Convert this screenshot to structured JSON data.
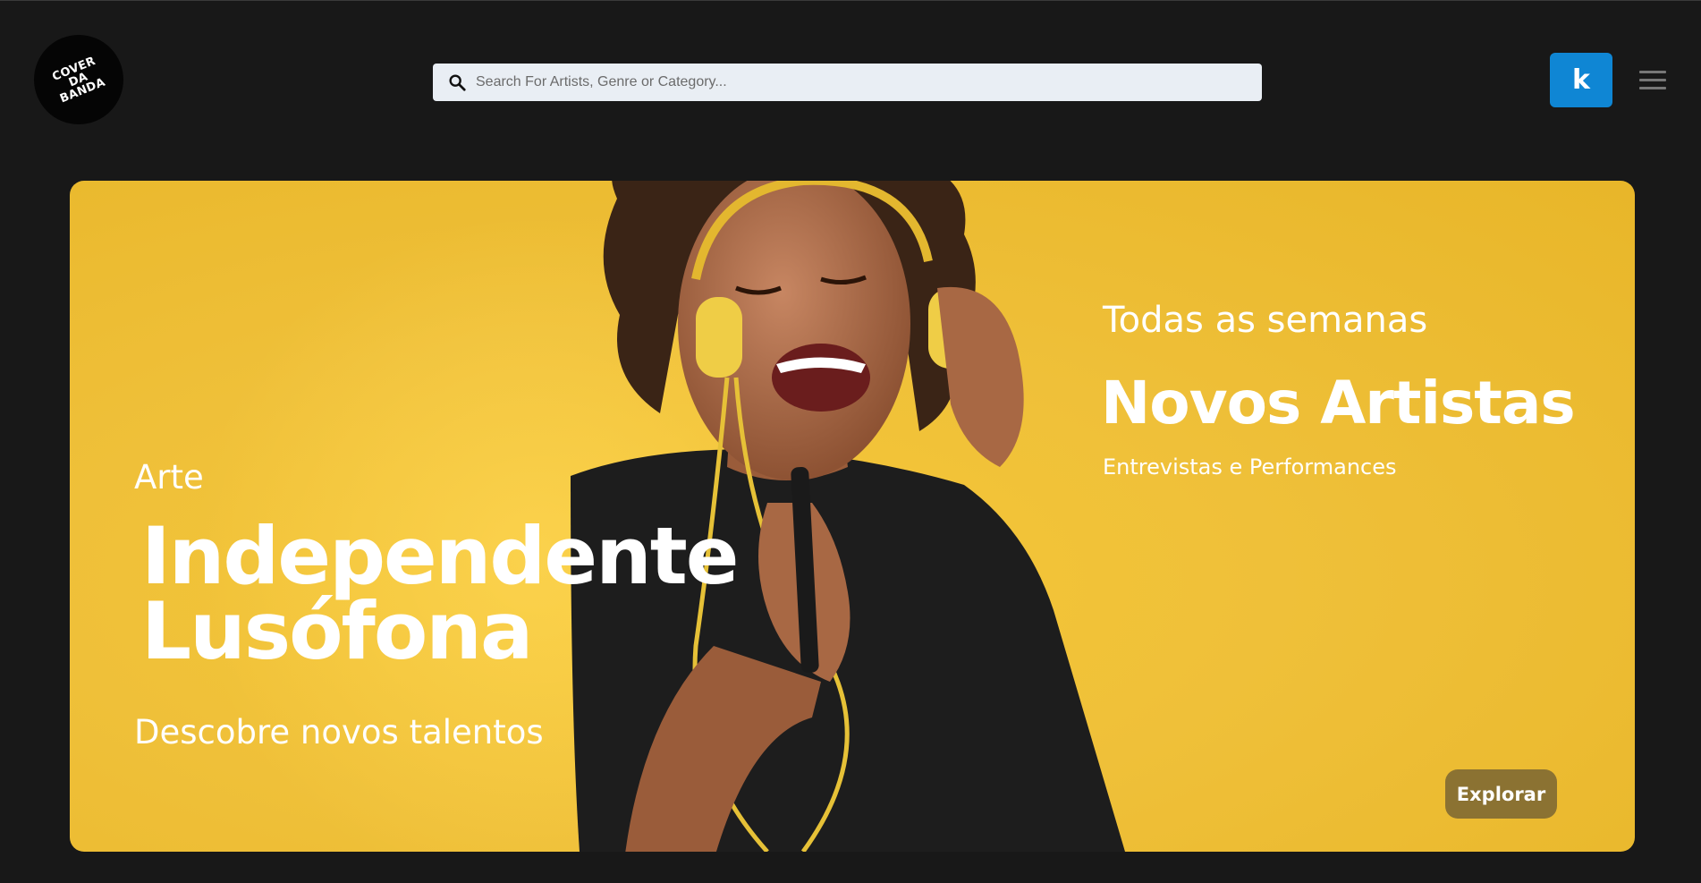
{
  "header": {
    "logo_text": "COVER\nDA\nBANDA",
    "search": {
      "placeholder": "Search For Artists, Genre or Category...",
      "value": ""
    },
    "avatar_letter": "k",
    "menu_icon": "hamburger-icon"
  },
  "hero": {
    "left": {
      "kicker": "Arte",
      "title_line1": "Independente",
      "title_line2": "Lusófona",
      "subtitle": "Descobre novos talentos"
    },
    "right": {
      "kicker": "Todas as semanas",
      "title": "Novos Artistas",
      "subtitle": "Entrevistas e Performances"
    },
    "cta_label": "Explorar"
  },
  "colors": {
    "background": "#181818",
    "hero_yellow": "#efc039",
    "avatar_blue": "#0f86d4",
    "button_olive": "#8b7232",
    "search_bg": "#e9eef4"
  }
}
